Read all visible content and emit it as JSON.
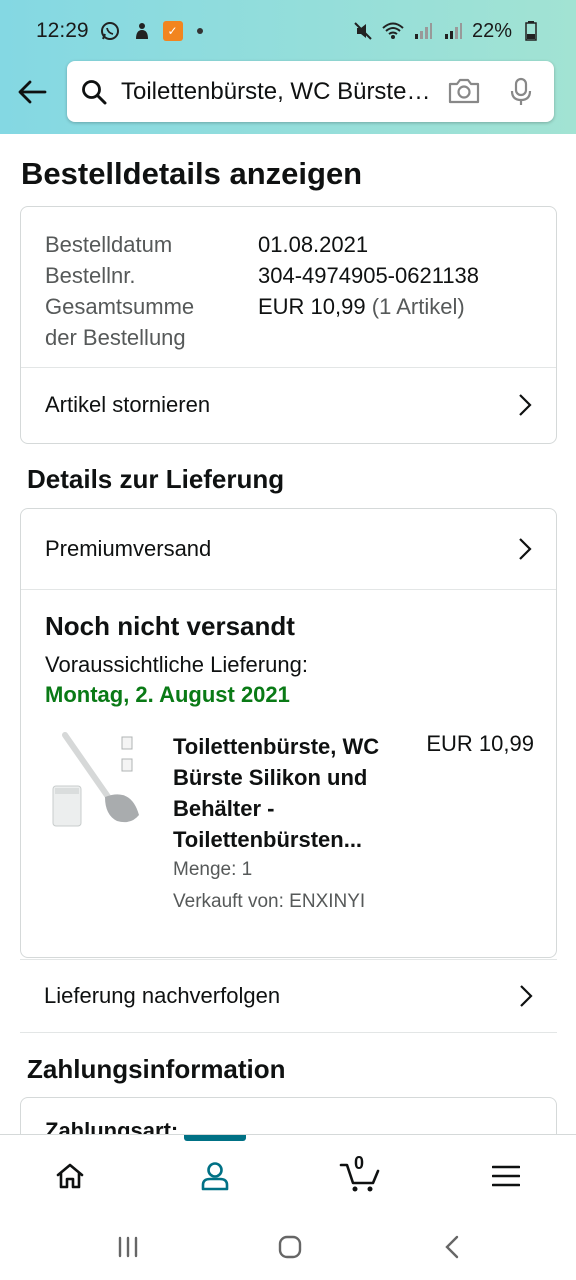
{
  "status_bar": {
    "time": "12:29",
    "battery": "22%",
    "icons": [
      "whatsapp-icon",
      "notification-icon",
      "app-badge-icon",
      "mute-icon",
      "wifi-icon",
      "signal-icon",
      "signal-icon",
      "battery-icon"
    ]
  },
  "search": {
    "query": "Toilettenbürste, WC Bürste Silikon und Behälter"
  },
  "page": {
    "title": "Bestelldetails anzeigen"
  },
  "order_summary": {
    "date_label": "Bestelldatum",
    "date_value": "01.08.2021",
    "number_label": "Bestellnr.",
    "number_value": "304-4974905-0621138",
    "total_label_line1": "Gesamtsumme",
    "total_label_line2": "der Bestellung",
    "total_value": "EUR 10,99",
    "total_items": "(1 Artikel)",
    "cancel_label": "Artikel stornieren"
  },
  "delivery": {
    "section_title": "Details zur Lieferung",
    "shipping_method": "Premiumversand",
    "status_heading": "Noch nicht versandt",
    "expected_label": "Voraussichtliche Lieferung:",
    "expected_date": "Montag, 2. August 2021",
    "product": {
      "title": "Toilettenbürste, WC Bürste Silikon und Behälter - Toilettenbürsten...",
      "price": "EUR 10,99",
      "quantity": "Menge: 1",
      "seller": "Verkauft von: ENXINYI"
    },
    "track_label": "Lieferung nachverfolgen"
  },
  "payment": {
    "section_title": "Zahlungsinformation",
    "method_label": "Zahlungsart:"
  },
  "bottom_nav": {
    "cart_count": "0",
    "active": "account"
  },
  "colors": {
    "header_start": "#84d8e3",
    "header_end": "#a2e3d3",
    "delivery_green": "#0a7a16",
    "nav_active": "#007185"
  }
}
